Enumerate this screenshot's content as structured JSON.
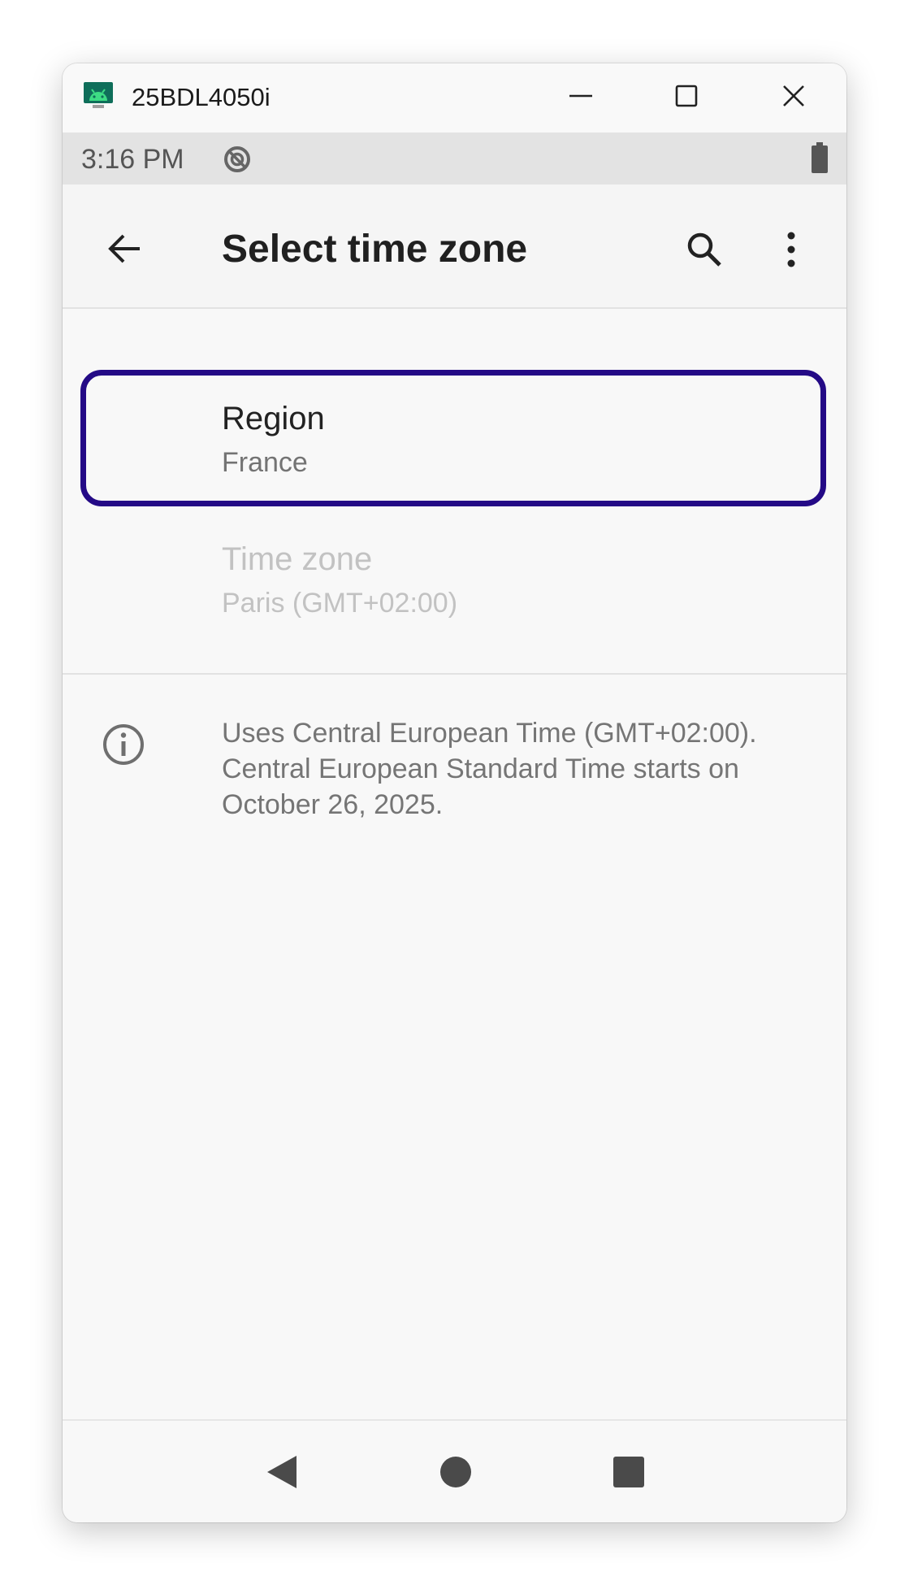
{
  "window": {
    "title": "25BDL4050i"
  },
  "status_bar": {
    "time": "3:16 PM"
  },
  "app_bar": {
    "title": "Select time zone"
  },
  "preferences": {
    "region": {
      "title": "Region",
      "summary": "France"
    },
    "time_zone": {
      "title": "Time zone",
      "summary": "Paris (GMT+02:00)"
    }
  },
  "info": {
    "text": "Uses Central European Time (GMT+02:00). Central European Standard Time starts on October 26, 2025."
  },
  "icons": {
    "app": "android-icon",
    "minimize": "minimize-icon",
    "maximize": "maximize-icon",
    "close": "close-icon",
    "status": "data-saver-icon",
    "battery": "battery-icon",
    "back": "arrow-back-icon",
    "search": "search-icon",
    "more": "more-vert-icon",
    "info": "info-icon",
    "nav_back": "nav-back-icon",
    "nav_home": "nav-home-icon",
    "nav_recents": "nav-recents-icon"
  },
  "colors": {
    "focus_ring": "#240a86",
    "app_icon": "#3ddc84"
  }
}
